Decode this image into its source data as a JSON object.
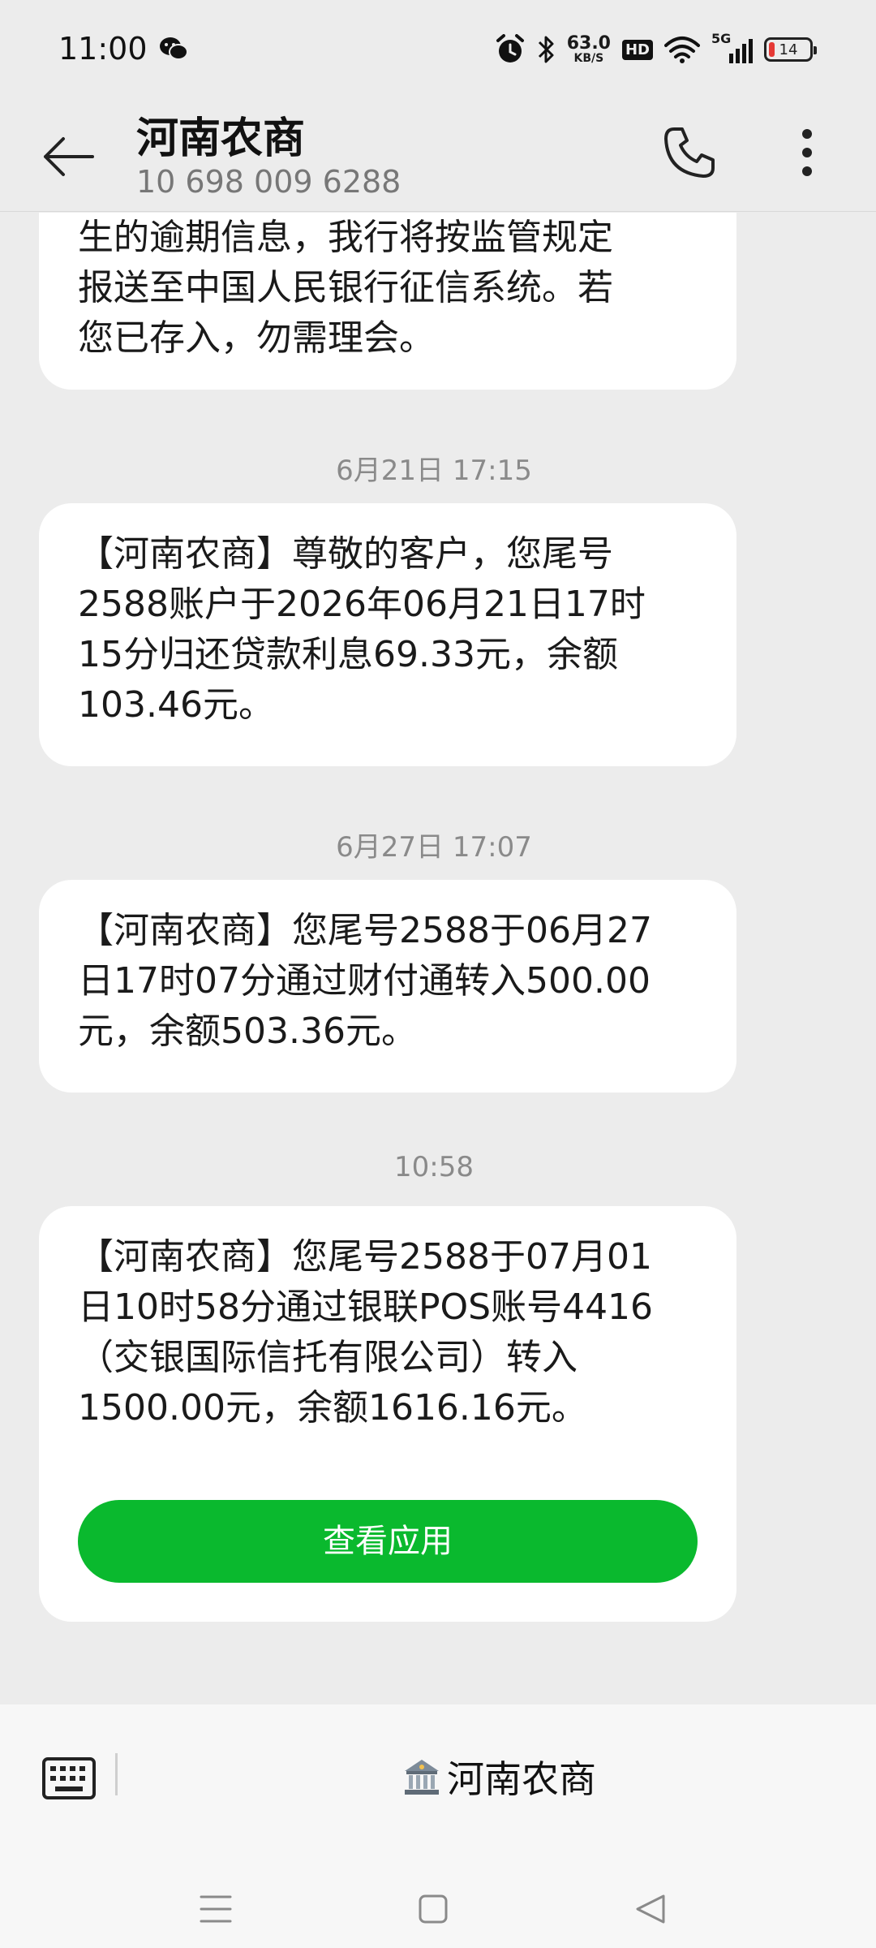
{
  "status_bar": {
    "time": "11:00",
    "network_speed_value": "63.0",
    "network_speed_unit": "KB/S",
    "hd_label": "HD",
    "signal_label": "5G",
    "battery_level": "14",
    "battery_fraction": 0.14,
    "battery_color": "#e53935",
    "icons": [
      "wechat-icon",
      "alarm-icon",
      "bluetooth-icon",
      "wifi-icon",
      "signal-icon",
      "battery-icon"
    ]
  },
  "header": {
    "title": "河南农商",
    "phone_number": "10 698 009 6288",
    "icons": [
      "back-arrow-icon",
      "phone-icon",
      "more-vertical-icon"
    ]
  },
  "messages": [
    {
      "timestamp": "",
      "lines": [
        "生的逾期信息，我行将按监管规定",
        "报送至中国人民银行征信系统。若",
        "您已存入，勿需理会。"
      ]
    },
    {
      "timestamp": "6月21日 17:15",
      "lines": [
        "【河南农商】尊敬的客户，您尾号",
        "2588账户于2026年06月21日17时",
        "15分归还贷款利息69.33元，余额",
        "103.46元。"
      ]
    },
    {
      "timestamp": "6月27日 17:07",
      "lines": [
        "【河南农商】您尾号2588于06月27",
        "日17时07分通过财付通转入500.00",
        "元，余额503.36元。"
      ]
    },
    {
      "timestamp": "10:58",
      "lines": [
        "【河南农商】您尾号2588于07月01",
        "日10时58分通过银联POS账号4416",
        "（交银国际信托有限公司）转入",
        "1500.00元，余额1616.16元。"
      ],
      "button_label": "查看应用"
    }
  ],
  "bottom_bar": {
    "menu_label": "河南农商",
    "menu_icon": "bank-icon",
    "icons": [
      "keyboard-icon",
      "nav-menu-icon",
      "nav-home-icon",
      "nav-back-icon"
    ]
  },
  "colors": {
    "accent_green": "#0ab92e",
    "background": "#ececec",
    "bubble": "#ffffff"
  }
}
